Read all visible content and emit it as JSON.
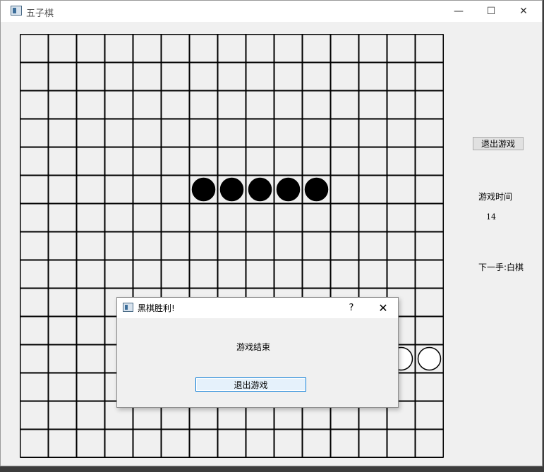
{
  "window": {
    "title": "五子棋",
    "controls": {
      "minimize": "—",
      "maximize": "☐",
      "close": "✕"
    }
  },
  "board": {
    "size": 15,
    "black_stones": [
      [
        6,
        5
      ],
      [
        7,
        5
      ],
      [
        8,
        5
      ],
      [
        9,
        5
      ],
      [
        10,
        5
      ]
    ],
    "white_stones": [
      [
        13,
        11
      ],
      [
        14,
        11
      ]
    ]
  },
  "sidebar": {
    "exit_button": "退出游戏",
    "time_label": "游戏时间",
    "time_value": "14",
    "next_move": "下一手:白棋"
  },
  "dialog": {
    "title": "黑棋胜利!",
    "help": "?",
    "close": "✕",
    "message": "游戏结束",
    "exit_button": "退出游戏"
  },
  "colors": {
    "black": "#000000",
    "white": "#ffffff",
    "line": "#000000",
    "accent": "#0078d7"
  }
}
